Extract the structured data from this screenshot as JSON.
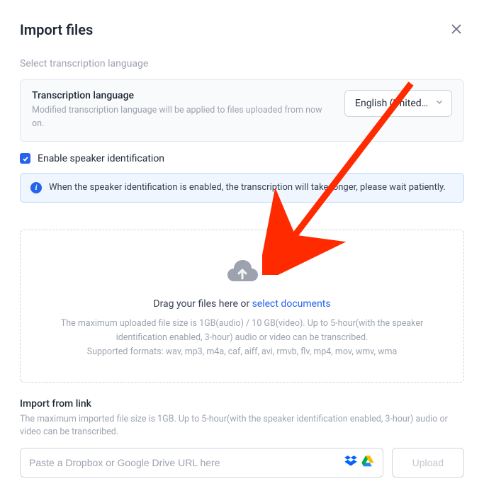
{
  "header": {
    "title": "Import files"
  },
  "language": {
    "section_label": "Select transcription language",
    "title": "Transcription language",
    "desc": "Modified transcription language will be applied to files uploaded from now on.",
    "selected": "English (United …"
  },
  "speaker": {
    "checkbox_label": "Enable speaker identification",
    "info_text": "When the speaker identification is enabled, the transcription will take longer, please wait patiently."
  },
  "dropzone": {
    "drag_text": "Drag your files here or ",
    "link_text": "select documents",
    "max_text": "The maximum uploaded file size is 1GB(audio) / 10 GB(video). Up to 5-hour(with the speaker identification enabled, 3-hour) audio or video can be transcribed.",
    "formats_text": "Supported formats: wav, mp3, m4a, caf, aiff, avi, rmvb, flv, mp4, mov, wmv, wma"
  },
  "import_link": {
    "title": "Import from link",
    "desc": "The maximum imported file size is 1GB. Up to 5-hour(with the speaker identification enabled, 3-hour) audio or video can be transcribed.",
    "placeholder": "Paste a Dropbox or Google Drive URL here",
    "upload_label": "Upload"
  }
}
